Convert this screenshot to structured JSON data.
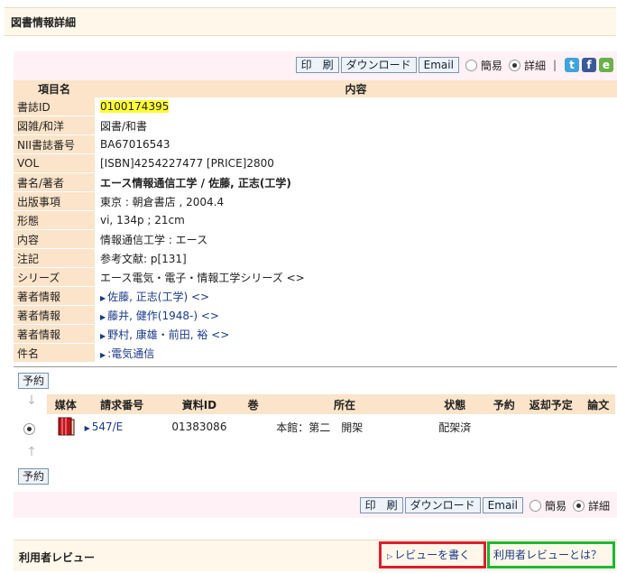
{
  "page": {
    "title": "図書情報詳細"
  },
  "toolbar": {
    "print": "印　刷",
    "download": "ダウンロード",
    "email": "Email",
    "simple": "簡易",
    "detail": "詳細",
    "separator": "|"
  },
  "social_icons": [
    "twitter-icon",
    "facebook-icon",
    "evernote-icon"
  ],
  "info_table": {
    "header_key": "項目名",
    "header_value": "内容",
    "rows": [
      {
        "k": "書誌ID",
        "v": "0100174395"
      },
      {
        "k": "図雑/和洋",
        "v": "図書/和書"
      },
      {
        "k": "NII書誌番号",
        "v": "BA67016543"
      },
      {
        "k": "VOL",
        "v": "[ISBN]4254227477 [PRICE]2800"
      },
      {
        "k": "書名/著者",
        "v": "エース情報通信工学 / 佐藤, 正志(工学)"
      },
      {
        "k": "出版事項",
        "v": "東京 : 朝倉書店 , 2004.4"
      },
      {
        "k": "形態",
        "v": "vi, 134p ; 21cm"
      },
      {
        "k": "内容",
        "v": "情報通信工学 : エース"
      },
      {
        "k": "注記",
        "v": "参考文献: p[131]"
      },
      {
        "k": "シリーズ",
        "v": "エース電気・電子・情報工学シリーズ <>"
      },
      {
        "k": "著者情報",
        "v": "佐藤, 正志(工学) <>"
      },
      {
        "k": "著者情報",
        "v": "藤井, 健作(1948-) <>"
      },
      {
        "k": "著者情報",
        "v": "野村, 康雄・前田, 裕 <>"
      },
      {
        "k": "件名",
        "v": ":電気通信"
      }
    ]
  },
  "reserve_label": "予約",
  "holdings": {
    "headers": [
      "媒体",
      "請求番号",
      "資料ID",
      "巻",
      "所在",
      "状態",
      "予約",
      "返却予定",
      "論文"
    ],
    "row": {
      "call_number": "547/E",
      "item_id": "01383086",
      "volume": "",
      "location": "本館：第二　開架",
      "status": "配架済",
      "reserve": "",
      "due": "",
      "paper": ""
    }
  },
  "review": {
    "title": "利用者レビュー",
    "write": "レビューを書く",
    "about": "利用者レビューとは？"
  },
  "colors": {
    "accent_red": "#dd1e2f",
    "accent_green": "#1db835",
    "highlight": "#ffff33"
  }
}
